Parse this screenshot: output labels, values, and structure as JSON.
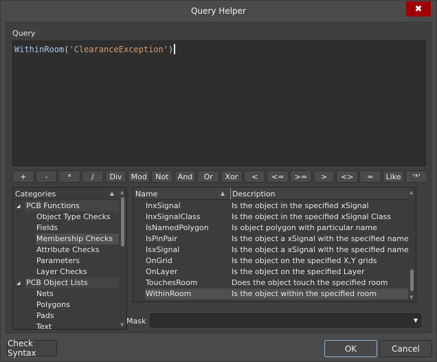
{
  "window": {
    "title": "Query Helper",
    "close_glyph": "✖"
  },
  "query": {
    "label": "Query",
    "function_name": "WithinRoom",
    "open_paren": "(",
    "argument": "'ClearanceException'",
    "close_paren": ")"
  },
  "operators": [
    "+",
    "-",
    "*",
    "/",
    "Div",
    "Mod",
    "Not",
    "And",
    "Or",
    "Xor",
    "<",
    "<=",
    ">=",
    ">",
    "<>",
    "=",
    "Like",
    "'*'"
  ],
  "categories": {
    "header": "Categories",
    "sort_glyph": "▲",
    "items": [
      {
        "label": "PCB Functions",
        "type": "group",
        "expanded": true
      },
      {
        "label": "Object Type Checks",
        "type": "child"
      },
      {
        "label": "Fields",
        "type": "child"
      },
      {
        "label": "Membership Checks",
        "type": "child",
        "selected": true
      },
      {
        "label": "Attribute Checks",
        "type": "child"
      },
      {
        "label": "Parameters",
        "type": "child"
      },
      {
        "label": "Layer Checks",
        "type": "child"
      },
      {
        "label": "PCB Object Lists",
        "type": "group",
        "expanded": true
      },
      {
        "label": "Nets",
        "type": "child"
      },
      {
        "label": "Polygons",
        "type": "child"
      },
      {
        "label": "Pads",
        "type": "child"
      },
      {
        "label": "Text",
        "type": "child"
      }
    ]
  },
  "functions": {
    "columns": {
      "name": "Name",
      "description": "Description",
      "sort_glyph": "▲"
    },
    "rows": [
      {
        "name": "InxSignal",
        "description": "Is the object in the specified xSignal"
      },
      {
        "name": "InxSignalClass",
        "description": "Is the object in the specified xSignal Class"
      },
      {
        "name": "IsNamedPolygon",
        "description": "Is object polygon with particular name"
      },
      {
        "name": "IsPinPair",
        "description": "Is the object a xSignal with the specified name"
      },
      {
        "name": "IsxSignal",
        "description": "Is the object a xSignal with the specified name"
      },
      {
        "name": "OnGrid",
        "description": "Is the object on the specified X,Y grids"
      },
      {
        "name": "OnLayer",
        "description": "Is the object on the specified Layer"
      },
      {
        "name": "TouchesRoom",
        "description": "Does the object touch the specified room"
      },
      {
        "name": "WithinRoom",
        "description": "Is the object within the specified room",
        "selected": true
      }
    ]
  },
  "mask": {
    "label": "Mask",
    "value": ""
  },
  "buttons": {
    "check_syntax": "Check Syntax",
    "ok": "OK",
    "cancel": "Cancel"
  }
}
